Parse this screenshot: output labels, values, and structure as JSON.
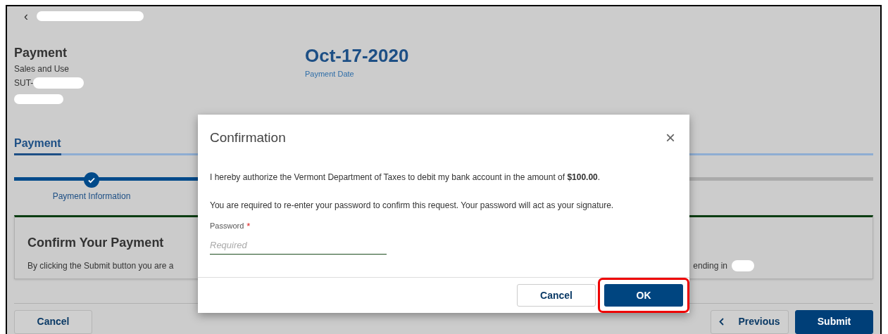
{
  "page": {
    "back_button": "‹",
    "title": "Payment",
    "subtitle": "Sales and Use",
    "account_prefix": "SUT-",
    "date": "Oct-17-2020",
    "date_label": "Payment Date"
  },
  "tabs": [
    {
      "label": "Payment",
      "selected": true
    }
  ],
  "steps": [
    {
      "label": "Payment Information",
      "completed": true
    }
  ],
  "card": {
    "title": "Confirm Your Payment",
    "text_left": "By clicking the Submit button you are a",
    "text_right": "ending in"
  },
  "footer_buttons": [
    {
      "label": "Cancel",
      "kind": "secondary"
    },
    {
      "label": "Previous",
      "kind": "back"
    },
    {
      "label": "Submit",
      "kind": "primary"
    }
  ],
  "dialog": {
    "title": "Confirmation",
    "close": "×",
    "message": "I hereby authorize the Vermont Department of Taxes to debit my bank account in the amount of **$100.00**.",
    "note": "You are required to re-enter your password to confirm this request. Your password will act as your signature.",
    "field": {
      "label": "Password",
      "required": true,
      "required_mark": "*",
      "placeholder": "Required"
    },
    "buttons": [
      {
        "label": "Cancel",
        "kind": "secondary",
        "highlighted": false
      },
      {
        "label": "OK",
        "kind": "primary",
        "highlighted": true
      }
    ]
  }
}
